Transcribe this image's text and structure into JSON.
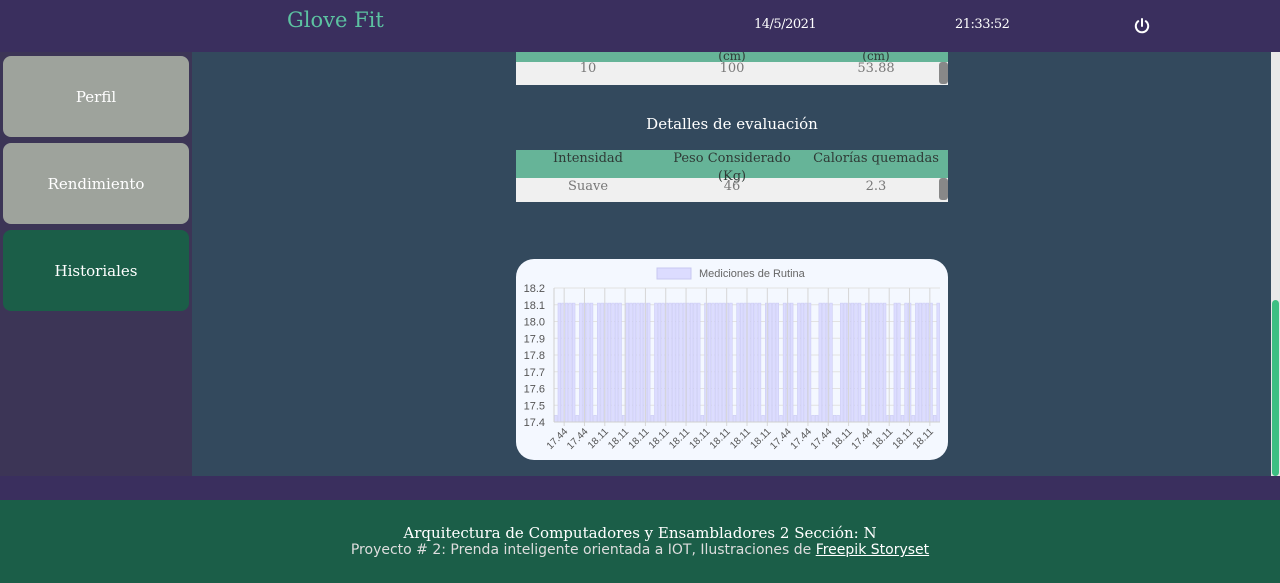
{
  "header": {
    "brand": "Glove Fit",
    "date": "14/5/2021",
    "time": "21:33:52",
    "power_icon": "power-icon"
  },
  "sidebar": {
    "items": [
      {
        "label": "Perfil",
        "active": false
      },
      {
        "label": "Rendimiento",
        "active": false
      },
      {
        "label": "Historiales",
        "active": true
      }
    ]
  },
  "table1": {
    "headers": [
      "",
      "(cm)",
      "(cm)"
    ],
    "row": [
      "10",
      "100",
      "53.88"
    ]
  },
  "evaluation": {
    "title": "Detalles de evaluación",
    "headers": [
      "Intensidad",
      "Peso Considerado (Kg)",
      "Calorías quemadas"
    ],
    "row": [
      "Suave",
      "46",
      "2.3"
    ]
  },
  "chart_data": {
    "type": "bar",
    "legend": "Mediciones de Rutina",
    "color": "#dcdcff",
    "ylim": [
      17.4,
      18.2
    ],
    "yticks": [
      "18.2",
      "18.1",
      "18.0",
      "17.9",
      "17.8",
      "17.7",
      "17.6",
      "17.5",
      "17.4"
    ],
    "xtick_labels": [
      "17.44",
      "17.44",
      "18.11",
      "18.11",
      "18.11",
      "18.11",
      "18.11",
      "18.11",
      "18.11",
      "18.11",
      "18.11",
      "17.44",
      "17.44",
      "17.44",
      "18.11",
      "17.44",
      "18.11",
      "18.11",
      "18.11"
    ],
    "values": [
      17.44,
      18.11,
      18.11,
      18.11,
      18.11,
      18.11,
      17.44,
      18.11,
      18.11,
      18.11,
      18.11,
      17.44,
      18.11,
      18.11,
      18.11,
      18.11,
      18.11,
      18.11,
      18.11,
      17.44,
      18.11,
      18.11,
      18.11,
      18.11,
      18.11,
      18.11,
      18.11,
      17.44,
      18.11,
      18.11,
      18.11,
      18.11,
      18.11,
      18.11,
      18.11,
      18.11,
      18.11,
      18.11,
      18.11,
      18.11,
      18.11,
      17.44,
      18.11,
      18.11,
      18.11,
      18.11,
      18.11,
      18.11,
      18.11,
      18.11,
      17.44,
      18.11,
      18.11,
      18.11,
      18.11,
      18.11,
      18.11,
      18.11,
      17.44,
      18.11,
      18.11,
      18.11,
      18.11,
      17.44,
      18.11,
      18.11,
      18.11,
      17.44,
      18.11,
      18.11,
      18.11,
      18.11,
      17.44,
      17.44,
      18.11,
      18.11,
      18.11,
      18.11,
      17.44,
      17.44,
      18.11,
      18.11,
      18.11,
      18.11,
      18.11,
      18.11,
      17.44,
      18.11,
      18.11,
      18.11,
      18.11,
      18.11,
      18.11,
      17.44,
      17.44,
      18.11,
      18.11,
      17.44,
      18.11,
      18.11,
      17.44,
      18.11,
      18.11,
      18.11,
      18.11,
      18.11,
      17.44,
      18.11
    ]
  },
  "footer": {
    "line1": "Arquitectura de Computadores y Ensambladores 2 Sección: N",
    "line2_prefix": "Proyecto # 2: Prenda inteligente orientada a IOT, Ilustraciones de ",
    "link": "Freepik Storyset"
  }
}
